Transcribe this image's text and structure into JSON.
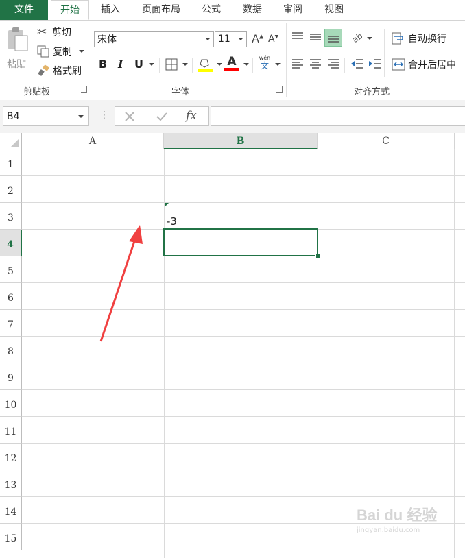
{
  "tabs": [
    "文件",
    "开始",
    "插入",
    "页面布局",
    "公式",
    "数据",
    "审阅",
    "视图"
  ],
  "clipboard": {
    "paste_label": "粘贴",
    "cut_label": "剪切",
    "copy_label": "复制",
    "format_painter_label": "格式刷",
    "group_label": "剪贴板"
  },
  "font": {
    "font_name": "宋体",
    "font_size": "11",
    "grow_label": "A",
    "shrink_label": "A",
    "bold_label": "B",
    "italic_label": "I",
    "underline_label": "U",
    "font_color_label": "A",
    "phonetic_top": "wén",
    "phonetic_bottom": "文",
    "group_label": "字体",
    "fill_color": "#ffff00",
    "font_color": "#ff0000"
  },
  "alignment": {
    "wrap_text_label": "自动换行",
    "merge_center_label": "合并后居中",
    "group_label": "对齐方式"
  },
  "formula_bar": {
    "name_box": "B4",
    "fx_label": "fx",
    "formula_value": ""
  },
  "grid": {
    "columns": [
      "A",
      "B",
      "C"
    ],
    "rows": [
      "1",
      "2",
      "3",
      "4",
      "5",
      "6",
      "7",
      "8",
      "9",
      "10",
      "11",
      "12",
      "13",
      "14",
      "15"
    ],
    "cell_B3": "-3",
    "selected_cell": "B4",
    "selected_color": "#217346"
  },
  "watermark": {
    "brand": "Bai du 经验",
    "url": "jingyan.baidu.com"
  }
}
